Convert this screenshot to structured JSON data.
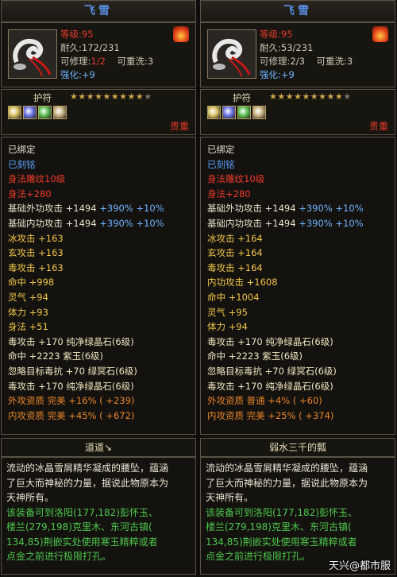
{
  "panels": [
    {
      "title": "飞雪",
      "level_label": "等级",
      "level_value": ":95",
      "durability": "耐久:172/231",
      "repair_label": "可修理:",
      "repair_value": "1/2",
      "rewash": "可重洗:3",
      "enhance_label": "强化:",
      "enhance_value": "+9",
      "rune_label": "护符",
      "stars_on": "★★★★★★★★★",
      "stars_off": "★",
      "rarity": "贵重",
      "attrs": [
        {
          "text": "已绑定",
          "color": "#e8e0cc"
        },
        {
          "text": "已刻铭",
          "color": "#5aa0ff"
        },
        {
          "text": "身法雕纹10级",
          "color": "#ee3a2c"
        },
        {
          "text": "身法+280",
          "color": "#ee3a2c"
        },
        {
          "text": "基础外功攻击 +1494",
          "extra": " +390% +10%",
          "color": "#e8e0cc"
        },
        {
          "text": "基础内功攻击 +1494",
          "extra": " +390% +10%",
          "color": "#e8e0cc"
        },
        {
          "text": "冰攻击 +163",
          "color": "#f0c64a"
        },
        {
          "text": "玄攻击 +163",
          "color": "#f0c64a"
        },
        {
          "text": "毒攻击 +163",
          "color": "#f0c64a"
        },
        {
          "text": "命中 +998",
          "color": "#f0c64a"
        },
        {
          "text": "灵气 +94",
          "color": "#f0c64a"
        },
        {
          "text": "体力 +93",
          "color": "#f0c64a"
        },
        {
          "text": "身法 +51",
          "color": "#f0c64a"
        },
        {
          "text": "毒攻击 +170 纯净绿晶石(6级)",
          "color": "#f0e4c0"
        },
        {
          "text": "命中 +2223 紫玉(6级)",
          "color": "#f0e4c0"
        },
        {
          "text": "忽略目标毒抗 +70 绿冥石(6级)",
          "color": "#f0e4c0"
        },
        {
          "text": "毒攻击 +170 纯净绿晶石(6级)",
          "color": "#f0e4c0"
        },
        {
          "text": "外攻资质  完美 +16% ( +239)",
          "color": "#e8862a"
        },
        {
          "text": "内攻资质  完美 +45% ( +672)",
          "color": "#e8862a"
        }
      ],
      "footer_title": "道道↘",
      "desc_white": [
        "流动的冰晶雪屑精华凝成的腰坠，蕴涵",
        "了巨大而神秘的力量，据说此物原本为",
        "天神所有。"
      ],
      "desc_green": [
        "该装备可到洛阳(177,182)彭怀玉、",
        "楼兰(279,198)克里木、东河古镇(",
        "134,85)荆嵌实处使用寒玉精粹或者",
        "点金之前进行极限打孔。"
      ]
    },
    {
      "title": "飞雪",
      "level_label": "等级",
      "level_value": ":95",
      "durability": "耐久:53/231",
      "repair_label": "可修理:",
      "repair_value": "2/3",
      "rewash": "可重洗:3",
      "enhance_label": "强化:",
      "enhance_value": "+9",
      "rune_label": "护符",
      "stars_on": "★★★★★★★★★",
      "stars_off": "★",
      "rarity": "贵重",
      "attrs": [
        {
          "text": "已绑定",
          "color": "#e8e0cc"
        },
        {
          "text": "已刻铭",
          "color": "#5aa0ff"
        },
        {
          "text": "身法雕纹10级",
          "color": "#ee3a2c"
        },
        {
          "text": "身法+280",
          "color": "#ee3a2c"
        },
        {
          "text": "基础外功攻击 +1494",
          "extra": " +390% +10%",
          "color": "#e8e0cc"
        },
        {
          "text": "基础内功攻击 +1494",
          "extra": " +390% +10%",
          "color": "#e8e0cc"
        },
        {
          "text": "冰攻击 +164",
          "color": "#f0c64a"
        },
        {
          "text": "玄攻击 +164",
          "color": "#f0c64a"
        },
        {
          "text": "毒攻击 +164",
          "color": "#f0c64a"
        },
        {
          "text": "内功攻击 +1608",
          "color": "#f0c64a"
        },
        {
          "text": "命中 +1004",
          "color": "#f0c64a"
        },
        {
          "text": "灵气 +95",
          "color": "#f0c64a"
        },
        {
          "text": "体力 +94",
          "color": "#f0c64a"
        },
        {
          "text": "毒攻击 +170 纯净绿晶石(6级)",
          "color": "#f0e4c0"
        },
        {
          "text": "命中 +2223 紫玉(6级)",
          "color": "#f0e4c0"
        },
        {
          "text": "忽略目标毒抗 +70 绿冥石(6级)",
          "color": "#f0e4c0"
        },
        {
          "text": "毒攻击 +170 纯净绿晶石(6级)",
          "color": "#f0e4c0"
        },
        {
          "text": "外攻资质  普通 +4% ( +60)",
          "color": "#e8862a"
        },
        {
          "text": "内攻资质  完美 +25% ( +374)",
          "color": "#e8862a"
        }
      ],
      "footer_title": "弱水三千的瓢",
      "desc_white": [
        "流动的冰晶雪屑精华凝成的腰坠，蕴涵",
        "了巨大而神秘的力量，据说此物原本为",
        "天神所有。"
      ],
      "desc_green": [
        "该装备可到洛阳(177,182)彭怀玉、",
        "楼兰(279,198)克里木、东河古镇(",
        "134,85)荆嵌实处使用寒玉精粹或者",
        "点金之前进行极限打孔。"
      ]
    }
  ],
  "gem_colors": [
    "#d6c060",
    "#6a70e0",
    "#5cc050",
    "#c8b080"
  ],
  "watermark": "天兴@都市服"
}
